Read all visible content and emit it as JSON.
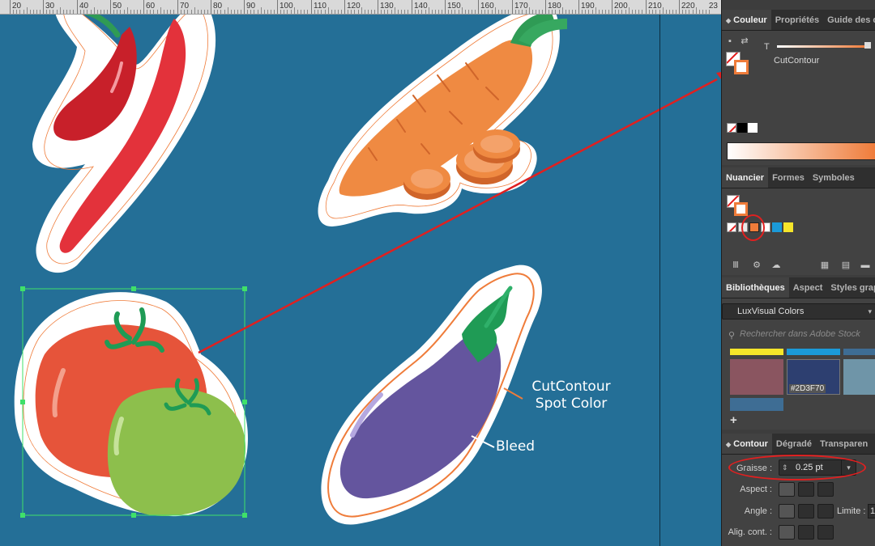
{
  "ruler": {
    "labels": [
      "20",
      "30",
      "40",
      "50",
      "60",
      "70",
      "80",
      "90",
      "100",
      "110",
      "120",
      "130",
      "140",
      "150",
      "160",
      "170",
      "180",
      "190",
      "200",
      "210",
      "220"
    ],
    "right_label": "23"
  },
  "canvas": {
    "callouts": {
      "cutcontour_line1": "CutContour",
      "cutcontour_line2": "Spot Color",
      "bleed": "Bleed"
    }
  },
  "color_panel": {
    "tabs": [
      "Couleur",
      "Propriétés",
      "Guide des c"
    ],
    "active_tab": "Couleur",
    "tint_label": "T",
    "swatch_name": "CutContour"
  },
  "swatches_panel": {
    "tabs": [
      "Nuancier",
      "Formes",
      "Symboles"
    ],
    "active_tab": "Nuancier"
  },
  "libraries_panel": {
    "tabs": [
      "Bibliothèques",
      "Aspect",
      "Styles grap"
    ],
    "active_tab": "Bibliothèques",
    "library_name": "LuxVisual Colors",
    "search_placeholder": "Rechercher dans Adobe Stock",
    "color_chip_label": "#2D3F70",
    "add_label": "+"
  },
  "stroke_panel": {
    "tabs": [
      "Contour",
      "Dégradé",
      "Transparen"
    ],
    "active_tab": "Contour",
    "weight_label": "Graisse :",
    "weight_value": "0.25 pt",
    "cap_label": "Aspect :",
    "corner_label": "Angle :",
    "limit_label": "Limite :",
    "limit_value": "1",
    "align_label": "Alig. cont. :"
  },
  "colors": {
    "canvas_bg": "#246f97",
    "panel_bg": "#424242",
    "cutcontour": "#ef7c3a",
    "annotation_red": "#e02020",
    "selection_green": "#3fe06a",
    "lib_yellow": "#f5e52a",
    "lib_blue": "#1b9ad8",
    "lib_steel": "#3e6d94",
    "lib_rose": "#8a5560",
    "lib_navy": "#2d3f70",
    "lib_gray_blue": "#6f95a8"
  }
}
